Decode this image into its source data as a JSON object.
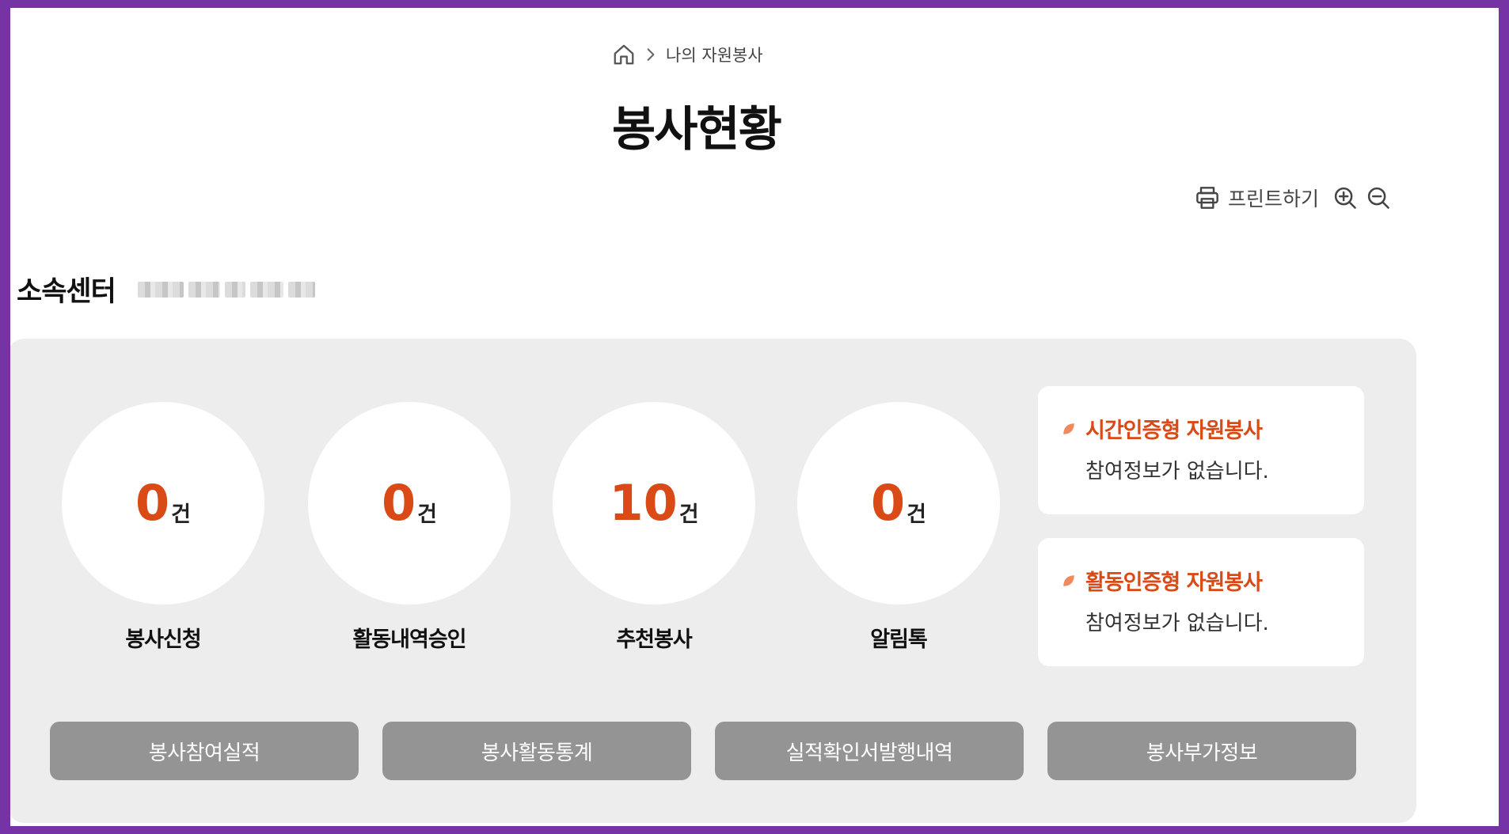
{
  "breadcrumb": {
    "home_icon": "home-icon",
    "separator_icon": "chevron-right-icon",
    "current": "나의 자원봉사"
  },
  "page": {
    "title": "봉사현황"
  },
  "tools": {
    "print_label": "프린트하기",
    "print_icon": "printer-icon",
    "zoom_in_icon": "zoom-in-icon",
    "zoom_out_icon": "zoom-out-icon"
  },
  "center": {
    "label": "소속센터",
    "value_blurred": true
  },
  "stats": [
    {
      "value": "0",
      "unit": "건",
      "label": "봉사신청"
    },
    {
      "value": "0",
      "unit": "건",
      "label": "활동내역승인"
    },
    {
      "value": "10",
      "unit": "건",
      "label": "추천봉사"
    },
    {
      "value": "0",
      "unit": "건",
      "label": "알림톡"
    }
  ],
  "info_cards": [
    {
      "title": "시간인증형 자원봉사",
      "body": "참여정보가 없습니다."
    },
    {
      "title": "활동인증형 자원봉사",
      "body": "참여정보가 없습니다."
    }
  ],
  "actions": [
    {
      "label": "봉사참여실적"
    },
    {
      "label": "봉사활동통계"
    },
    {
      "label": "실적확인서발행내역"
    },
    {
      "label": "봉사부가정보"
    }
  ],
  "colors": {
    "frame": "#7533a6",
    "accent": "#d94a16",
    "panel_bg": "#ededed",
    "button_bg": "#949494",
    "leaf": "#f08a5d"
  }
}
